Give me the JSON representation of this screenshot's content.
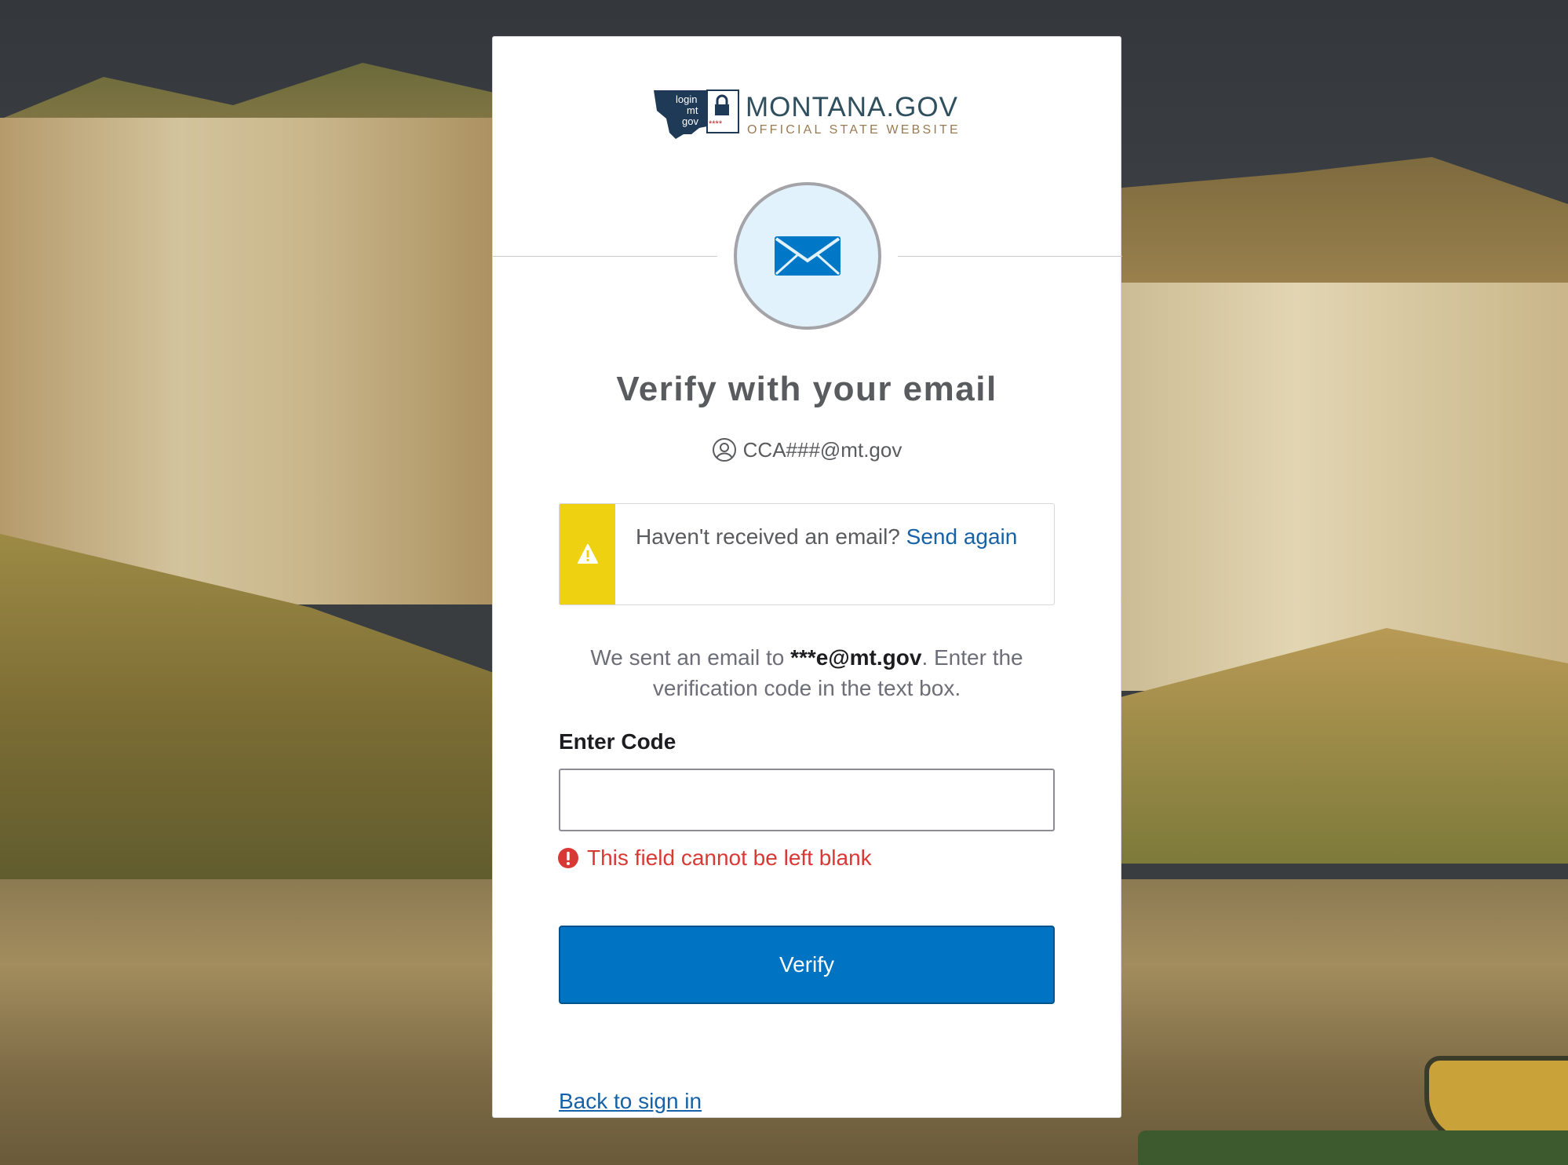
{
  "logo": {
    "mark_lines": [
      "login",
      "mt",
      "gov"
    ],
    "title": "MONTANA.GOV",
    "subtitle": "OFFICIAL STATE WEBSITE"
  },
  "factor": {
    "icon": "envelope-icon",
    "accent_color": "#0078c8"
  },
  "title": "Verify with your email",
  "identifier": "CCA###@mt.gov",
  "callout": {
    "icon": "warning-icon",
    "text": "Haven't received an email?",
    "link": "Send again",
    "bar_color": "#eed211"
  },
  "info": {
    "prefix": "We sent an email to ",
    "email": "***e@mt.gov",
    "suffix": ". Enter the verification code in the text box."
  },
  "form": {
    "code_label": "Enter Code",
    "code_value": "",
    "error": "This field cannot be left blank",
    "error_color": "#d93934",
    "submit_label": "Verify",
    "submit_color": "#0074c2"
  },
  "back_link": "Back to sign in"
}
